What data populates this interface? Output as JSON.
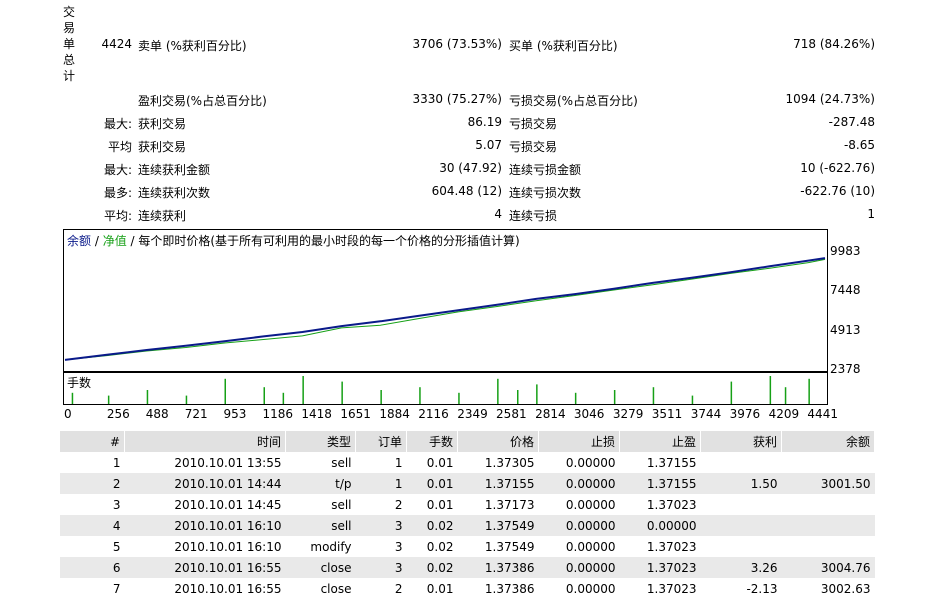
{
  "summary": {
    "vertical_label": [
      "交",
      "易",
      "单",
      "总",
      "计"
    ],
    "total_trades": "4424",
    "sell_label": "卖单 (%获利百分比)",
    "sell_value": "3706 (73.53%)",
    "buy_label": "买单 (%获利百分比)",
    "buy_value": "718 (84.26%)",
    "profit_trades_label": "盈利交易(%占总百分比)",
    "profit_trades_value": "3330 (75.27%)",
    "loss_trades_label": "亏损交易(%占总百分比)",
    "loss_trades_value": "1094 (24.73%)",
    "rows": [
      {
        "prefix": "最大:",
        "left_label": "获利交易",
        "left_value": "86.19",
        "right_label": "亏损交易",
        "right_value": "-287.48"
      },
      {
        "prefix": "平均",
        "left_label": "获利交易",
        "left_value": "5.07",
        "right_label": "亏损交易",
        "right_value": "-8.65"
      },
      {
        "prefix": "最大:",
        "left_label": "连续获利金额",
        "left_value": "30 (47.92)",
        "right_label": "连续亏损金额",
        "right_value": "10 (-622.76)"
      },
      {
        "prefix": "最多:",
        "left_label": "连续获利次数",
        "left_value": "604.48 (12)",
        "right_label": "连续亏损次数",
        "right_value": "-622.76 (10)"
      },
      {
        "prefix": "平均:",
        "left_label": "连续获利",
        "left_value": "4",
        "right_label": "连续亏损",
        "right_value": "1"
      }
    ]
  },
  "chart": {
    "legend_balance": "余额",
    "legend_sep": " / ",
    "legend_equity": "净值",
    "legend_desc": " / 每个即时价格(基于所有可利用的最小时段的每一个价格的分形插值计算)",
    "volume_label": "手数",
    "balance_color": "#0a1a8a",
    "equity_color": "#16a016"
  },
  "chart_data": {
    "type": "line",
    "y_ticks": [
      "9983",
      "7448",
      "4913",
      "2378"
    ],
    "ylim": [
      2378,
      10300
    ],
    "x_ticks": [
      "0",
      "256",
      "488",
      "721",
      "953",
      "1186",
      "1418",
      "1651",
      "1884",
      "2116",
      "2349",
      "2581",
      "2814",
      "3046",
      "3279",
      "3511",
      "3744",
      "3976",
      "4209",
      "4441"
    ],
    "xlim": [
      0,
      4540
    ],
    "series": [
      {
        "name": "余额",
        "x": [
          0,
          256,
          488,
          721,
          953,
          1186,
          1418,
          1651,
          1884,
          2116,
          2349,
          2581,
          2814,
          3046,
          3279,
          3511,
          3744,
          3976,
          4209,
          4441,
          4540
        ],
        "values": [
          3001,
          3300,
          3560,
          3800,
          4050,
          4320,
          4570,
          4900,
          5170,
          5480,
          5790,
          6100,
          6430,
          6700,
          7000,
          7330,
          7620,
          7930,
          8260,
          8580,
          8720
        ]
      },
      {
        "name": "净值",
        "x": [
          0,
          256,
          488,
          721,
          953,
          1186,
          1418,
          1651,
          1884,
          2116,
          2349,
          2581,
          2814,
          3046,
          3279,
          3511,
          3744,
          3976,
          4209,
          4441,
          4540
        ],
        "values": [
          3001,
          3250,
          3500,
          3700,
          3950,
          4150,
          4350,
          4800,
          4950,
          5330,
          5700,
          6000,
          6320,
          6620,
          6930,
          7220,
          7540,
          7860,
          8150,
          8470,
          8650
        ]
      }
    ],
    "volume_x": [
      40,
      256,
      488,
      721,
      953,
      1186,
      1300,
      1418,
      1651,
      1884,
      2116,
      2349,
      2581,
      2700,
      2814,
      3046,
      3279,
      3511,
      3744,
      3976,
      4209,
      4300,
      4441
    ],
    "volume_values": [
      0.4,
      0.3,
      0.5,
      0.3,
      0.9,
      0.6,
      0.4,
      1.0,
      0.8,
      0.5,
      0.6,
      0.4,
      0.9,
      0.5,
      0.7,
      0.4,
      0.5,
      0.6,
      0.3,
      0.8,
      1.0,
      0.6,
      0.9
    ]
  },
  "table": {
    "headers": [
      "#",
      "时间",
      "类型",
      "订单",
      "手数",
      "价格",
      "止损",
      "止盈",
      "获利",
      "余额"
    ],
    "rows": [
      [
        "1",
        "2010.10.01 13:55",
        "sell",
        "1",
        "0.01",
        "1.37305",
        "0.00000",
        "1.37155",
        "",
        ""
      ],
      [
        "2",
        "2010.10.01 14:44",
        "t/p",
        "1",
        "0.01",
        "1.37155",
        "0.00000",
        "1.37155",
        "1.50",
        "3001.50"
      ],
      [
        "3",
        "2010.10.01 14:45",
        "sell",
        "2",
        "0.01",
        "1.37173",
        "0.00000",
        "1.37023",
        "",
        ""
      ],
      [
        "4",
        "2010.10.01 16:10",
        "sell",
        "3",
        "0.02",
        "1.37549",
        "0.00000",
        "0.00000",
        "",
        ""
      ],
      [
        "5",
        "2010.10.01 16:10",
        "modify",
        "3",
        "0.02",
        "1.37549",
        "0.00000",
        "1.37023",
        "",
        ""
      ],
      [
        "6",
        "2010.10.01 16:55",
        "close",
        "3",
        "0.02",
        "1.37386",
        "0.00000",
        "1.37023",
        "3.26",
        "3004.76"
      ],
      [
        "7",
        "2010.10.01 16:55",
        "close",
        "2",
        "0.01",
        "1.37386",
        "0.00000",
        "1.37023",
        "-2.13",
        "3002.63"
      ]
    ]
  }
}
